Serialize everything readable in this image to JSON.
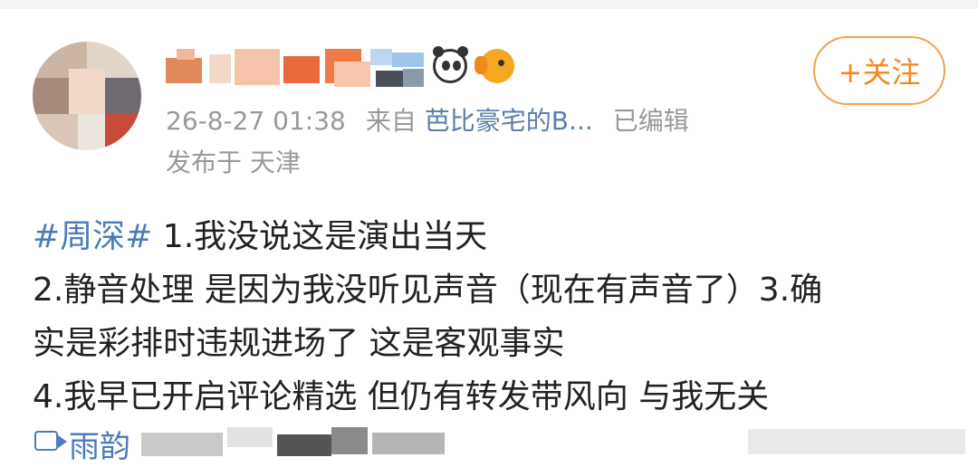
{
  "post": {
    "timestamp": "26-8-27 01:38",
    "source_prefix": "来自",
    "source_name": "芭比豪宅的B...",
    "edited": "已编辑",
    "location": "发布于 天津",
    "follow_label": "+关注",
    "hashtag": "#周深#",
    "lines": [
      " 1.我没说这是演出当天",
      "2.静音处理 是因为我没听见声音（现在有声音了）3.确",
      "实是彩排时违规进场了 这是客观事实",
      "4.我早已开启评论精选 但仍有转发带风向 与我无关"
    ],
    "video_label": "雨韵"
  },
  "icons": [
    "panda-icon",
    "fish-icon",
    "video-icon"
  ],
  "colors": {
    "link": "#4c7bbd",
    "follow_accent": "#f08a1c",
    "meta_gray": "#999999"
  }
}
